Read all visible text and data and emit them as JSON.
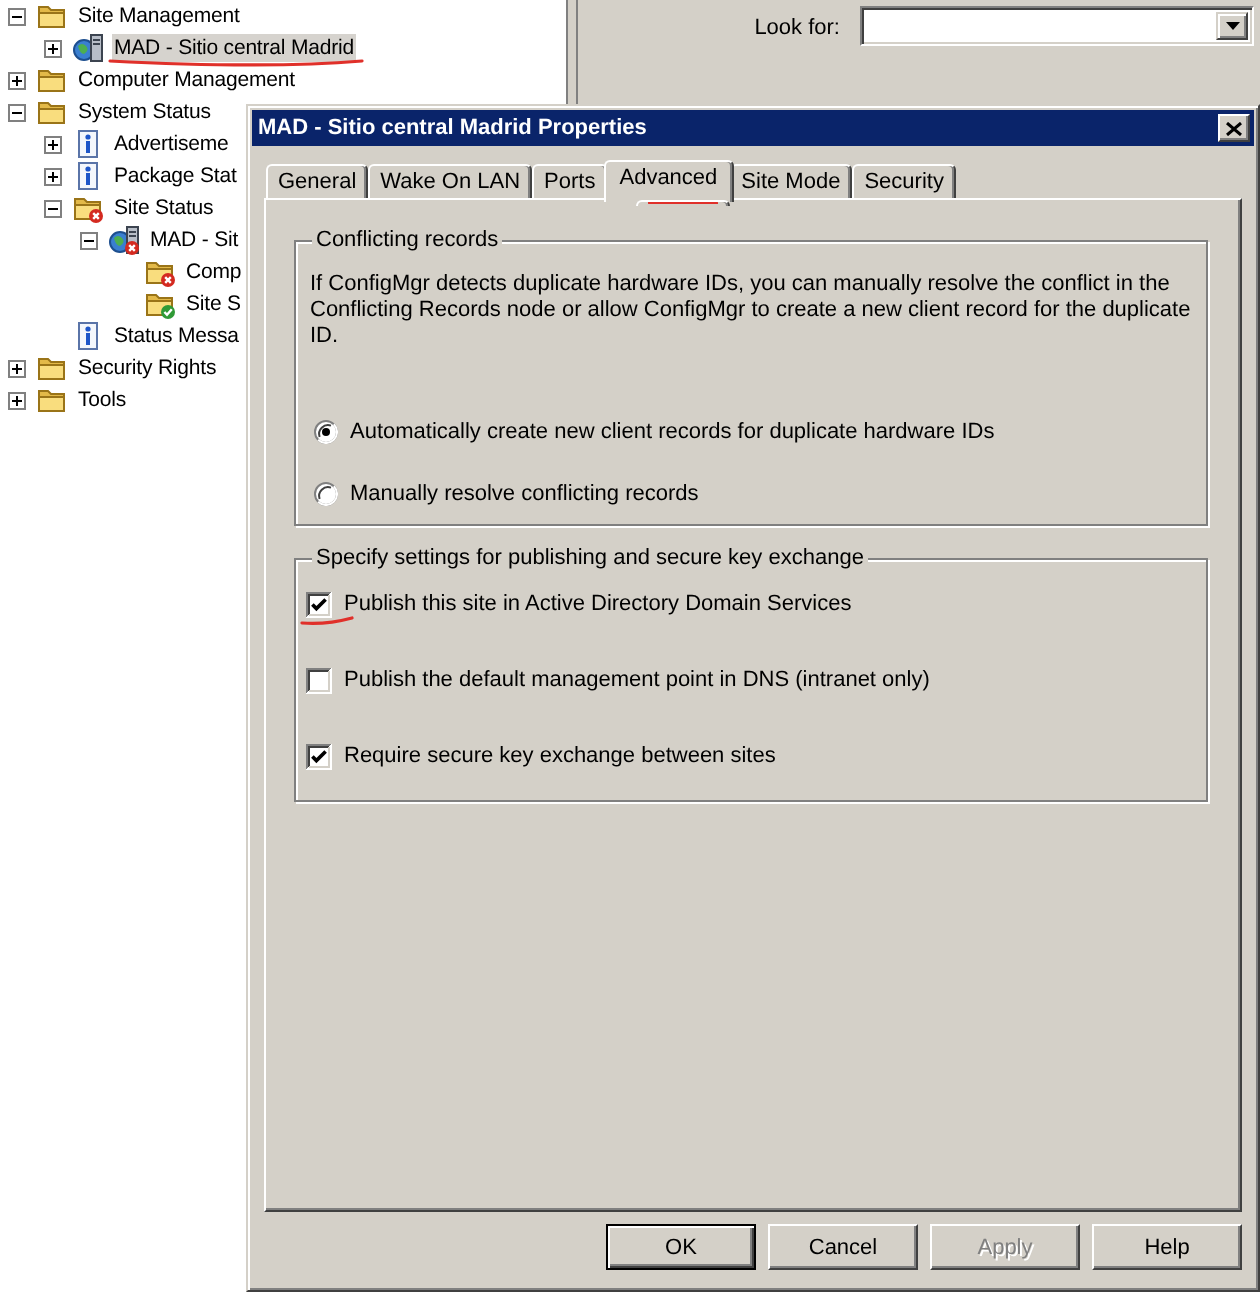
{
  "tree": [
    {
      "label": "Site Management",
      "kind": "folder",
      "error": false,
      "ok": false,
      "expanded": true,
      "selected": false,
      "annotated": false,
      "children": [
        {
          "label": "MAD - Sitio central Madrid",
          "kind": "site",
          "error": false,
          "ok": false,
          "expanded": false,
          "selected": true,
          "annotated": true
        }
      ]
    },
    {
      "label": "Computer Management",
      "kind": "folder",
      "error": false,
      "ok": false,
      "expanded": false,
      "selected": false,
      "annotated": false
    },
    {
      "label": "System Status",
      "kind": "folder",
      "error": false,
      "ok": false,
      "expanded": true,
      "selected": false,
      "annotated": false,
      "children": [
        {
          "label": "Advertiseme",
          "kind": "info",
          "error": false,
          "ok": false,
          "expanded": false,
          "selected": false,
          "annotated": false
        },
        {
          "label": "Package Stat",
          "kind": "info",
          "error": false,
          "ok": false,
          "expanded": false,
          "selected": false,
          "annotated": false
        },
        {
          "label": "Site Status",
          "kind": "folder",
          "error": true,
          "ok": false,
          "expanded": true,
          "selected": false,
          "annotated": false,
          "children": [
            {
              "label": "MAD - Sit",
              "kind": "site",
              "error": true,
              "ok": false,
              "expanded": true,
              "selected": false,
              "annotated": false,
              "children": [
                {
                  "label": "Comp",
                  "kind": "folder",
                  "error": true,
                  "ok": false,
                  "selected": false,
                  "annotated": false
                },
                {
                  "label": "Site S",
                  "kind": "folder",
                  "error": false,
                  "ok": true,
                  "selected": false,
                  "annotated": false
                }
              ]
            }
          ]
        },
        {
          "label": "Status Messa",
          "kind": "info",
          "error": false,
          "ok": false,
          "selected": false,
          "annotated": false
        }
      ]
    },
    {
      "label": "Security Rights",
      "kind": "folder",
      "error": false,
      "ok": false,
      "expanded": false,
      "selected": false,
      "annotated": false
    },
    {
      "label": "Tools",
      "kind": "folder",
      "error": false,
      "ok": false,
      "expanded": false,
      "selected": false,
      "annotated": false
    }
  ],
  "look_for": {
    "label": "Look for:"
  },
  "dialog": {
    "title": "MAD - Sitio central Madrid Properties",
    "tabs": [
      {
        "label": "General",
        "selected": false,
        "annotated": false
      },
      {
        "label": "Wake On LAN",
        "selected": false,
        "annotated": false
      },
      {
        "label": "Ports",
        "selected": false,
        "annotated": false
      },
      {
        "label": "Advanced",
        "selected": true,
        "annotated": true
      },
      {
        "label": "Site Mode",
        "selected": false,
        "annotated": false
      },
      {
        "label": "Security",
        "selected": false,
        "annotated": false
      }
    ],
    "groups": [
      {
        "title": "Conflicting records",
        "description": "If ConfigMgr detects duplicate hardware IDs, you can manually resolve the conflict in the Conflicting Records node or allow ConfigMgr to create a new client record for the duplicate ID.",
        "options": [
          {
            "kind": "radio",
            "label": "Automatically create new client records for duplicate hardware IDs",
            "selected": true,
            "annotated": false
          },
          {
            "kind": "radio",
            "label": "Manually resolve conflicting records",
            "selected": false,
            "annotated": false
          }
        ]
      },
      {
        "title": "Specify settings for publishing and secure key exchange",
        "options": [
          {
            "kind": "checkbox",
            "label": "Publish this site in Active Directory Domain Services",
            "checked": true,
            "annotated": true
          },
          {
            "kind": "checkbox",
            "label": "Publish the default management point in DNS (intranet only)",
            "checked": false,
            "annotated": false
          },
          {
            "kind": "checkbox",
            "label": "Require secure key exchange between sites",
            "checked": true,
            "annotated": false
          }
        ]
      }
    ],
    "buttons": [
      {
        "label": "OK",
        "default": true,
        "disabled": false
      },
      {
        "label": "Cancel",
        "default": false,
        "disabled": false
      },
      {
        "label": "Apply",
        "default": false,
        "disabled": true
      },
      {
        "label": "Help",
        "default": false,
        "disabled": false
      }
    ]
  }
}
